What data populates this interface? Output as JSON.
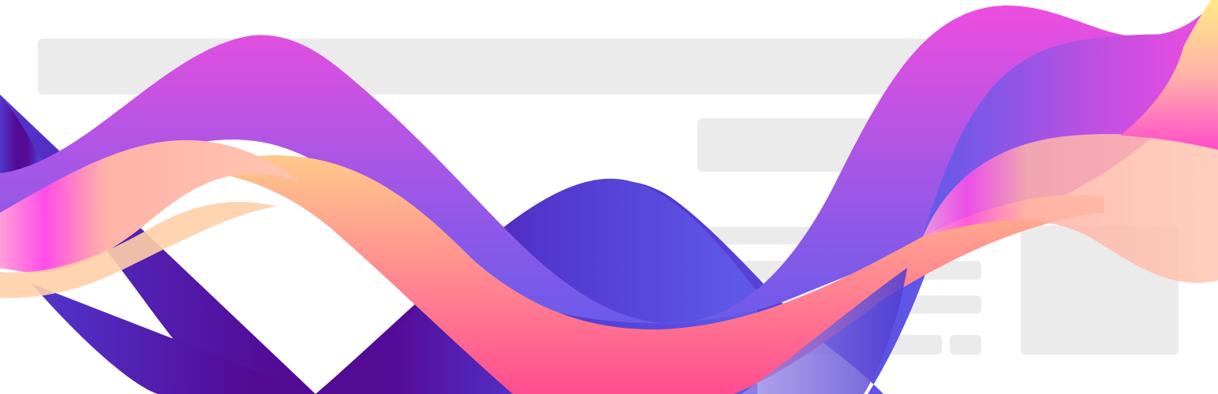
{
  "illustration": {
    "kind": "decorative abstract wave banner over placeholder UI skeleton",
    "colors": {
      "background": "#ffffff",
      "placeholder": "#ebebeb",
      "deep_purple": "#520A94",
      "violet": "#5236CE",
      "indigo": "#5F5BEA",
      "magenta": "#F04DDF",
      "pink": "#FF4D90",
      "peach": "#FFC98A",
      "yellow": "#FFE985"
    }
  }
}
